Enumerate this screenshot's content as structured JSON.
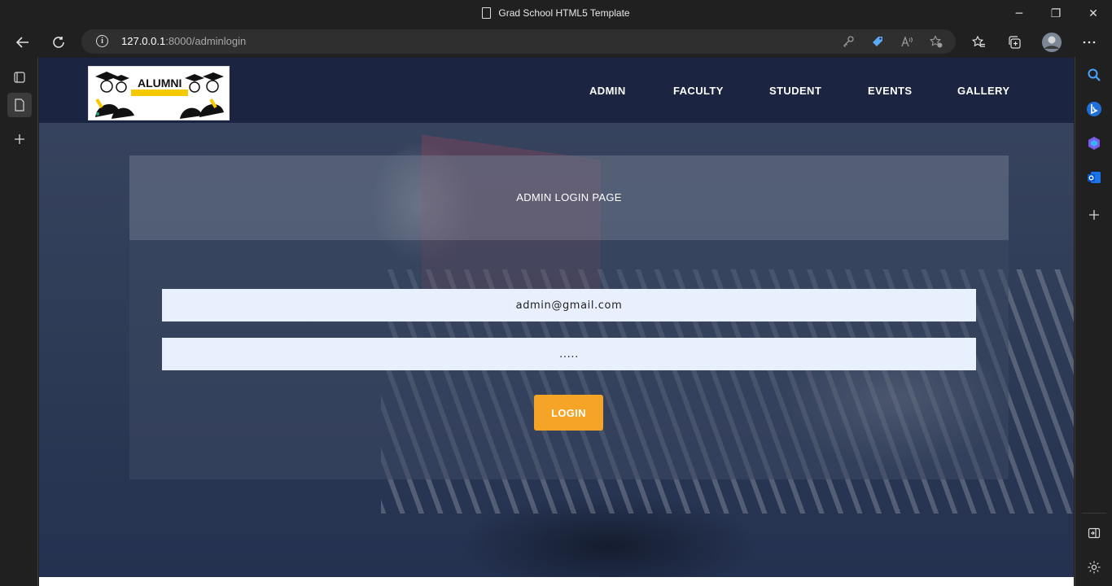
{
  "window": {
    "title": "Grad School HTML5 Template",
    "controls": {
      "minimize": "─",
      "maximize": "❐",
      "close": "✕"
    }
  },
  "browser": {
    "url_host": "127.0.0.1",
    "url_path": ":8000/adminlogin",
    "icons": [
      "back-icon",
      "refresh-icon",
      "info-icon",
      "key-icon",
      "coupon-tag-icon",
      "read-aloud-icon",
      "add-favorite-icon",
      "favorites-icon",
      "collections-icon",
      "profile-avatar",
      "more-icon"
    ]
  },
  "left_strip": {
    "icons": [
      "tab-actions-icon",
      "page-tab-icon",
      "new-tab-icon"
    ]
  },
  "right_strip": {
    "icons": [
      "search-icon",
      "bing-icon",
      "copilot-icon",
      "outlook-icon",
      "add-icon",
      "sidebar-toggle-icon",
      "settings-icon"
    ]
  },
  "site": {
    "logo_text": "ALUMNI",
    "nav": [
      "ADMIN",
      "FACULTY",
      "STUDENT",
      "EVENTS",
      "GALLERY"
    ],
    "login": {
      "heading": "ADMIN LOGIN PAGE",
      "email_value": "admin@gmail.com",
      "password_value": ".....",
      "button_label": "LOGIN"
    }
  },
  "colors": {
    "accent": "#f5a425",
    "navbar": "#1b2541",
    "input_bg": "#e8f0fe"
  }
}
